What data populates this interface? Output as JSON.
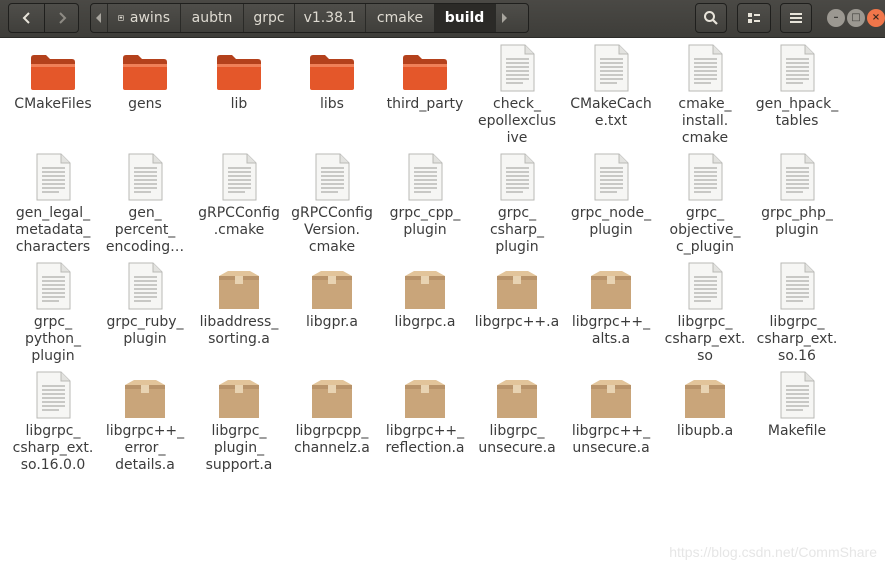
{
  "toolbar": {
    "back_icon": "chevron-left-icon",
    "forward_icon": "chevron-right-icon",
    "search_icon": "search-icon",
    "view_icon": "view-options-icon",
    "menu_icon": "hamburger-menu-icon"
  },
  "path": {
    "crumbs": [
      "awins",
      "aubtn",
      "grpc",
      "v1.38.1",
      "cmake",
      "build"
    ],
    "active_index": 5
  },
  "window_controls": {
    "minimize": "–",
    "maximize": "□",
    "close": "×"
  },
  "colors": {
    "header_bg": "#43423e",
    "folder_orange": "#e4572a",
    "close_orange": "#f0764a",
    "label_text": "#3c3c3c"
  },
  "files": [
    {
      "label": "CMakeFiles",
      "type": "folder"
    },
    {
      "label": "gens",
      "type": "folder"
    },
    {
      "label": "lib",
      "type": "folder"
    },
    {
      "label": "libs",
      "type": "folder"
    },
    {
      "label": "third_party",
      "type": "folder"
    },
    {
      "label": "check_\nepollexclus\nive",
      "type": "text"
    },
    {
      "label": "CMakeCach\ne.txt",
      "type": "text"
    },
    {
      "label": "cmake_\ninstall.\ncmake",
      "type": "text"
    },
    {
      "label": "gen_hpack_\ntables",
      "type": "text"
    },
    {
      "label": "gen_legal_\nmetadata_\ncharacters",
      "type": "text"
    },
    {
      "label": "gen_\npercent_\nencoding…",
      "type": "text"
    },
    {
      "label": "gRPCConfig\n.cmake",
      "type": "text"
    },
    {
      "label": "gRPCConfig\nVersion.\ncmake",
      "type": "text"
    },
    {
      "label": "grpc_cpp_\nplugin",
      "type": "text"
    },
    {
      "label": "grpc_\ncsharp_\nplugin",
      "type": "text"
    },
    {
      "label": "grpc_node_\nplugin",
      "type": "text"
    },
    {
      "label": "grpc_\nobjective_\nc_plugin",
      "type": "text"
    },
    {
      "label": "grpc_php_\nplugin",
      "type": "text"
    },
    {
      "label": "grpc_\npython_\nplugin",
      "type": "text"
    },
    {
      "label": "grpc_ruby_\nplugin",
      "type": "text"
    },
    {
      "label": "libaddress_\nsorting.a",
      "type": "archive"
    },
    {
      "label": "libgpr.a",
      "type": "archive"
    },
    {
      "label": "libgrpc.a",
      "type": "archive"
    },
    {
      "label": "libgrpc++.a",
      "type": "archive"
    },
    {
      "label": "libgrpc++_\nalts.a",
      "type": "archive"
    },
    {
      "label": "libgrpc_\ncsharp_ext.\nso",
      "type": "text"
    },
    {
      "label": "libgrpc_\ncsharp_ext.\nso.16",
      "type": "text"
    },
    {
      "label": "libgrpc_\ncsharp_ext.\nso.16.0.0",
      "type": "text"
    },
    {
      "label": "libgrpc++_\nerror_\ndetails.a",
      "type": "archive"
    },
    {
      "label": "libgrpc_\nplugin_\nsupport.a",
      "type": "archive"
    },
    {
      "label": "libgrpcpp_\nchannelz.a",
      "type": "archive"
    },
    {
      "label": "libgrpc++_\nreflection.a",
      "type": "archive"
    },
    {
      "label": "libgrpc_\nunsecure.a",
      "type": "archive"
    },
    {
      "label": "libgrpc++_\nunsecure.a",
      "type": "archive"
    },
    {
      "label": "libupb.a",
      "type": "archive"
    },
    {
      "label": "Makefile",
      "type": "text"
    }
  ],
  "watermark": "https://blog.csdn.net/CommShare"
}
